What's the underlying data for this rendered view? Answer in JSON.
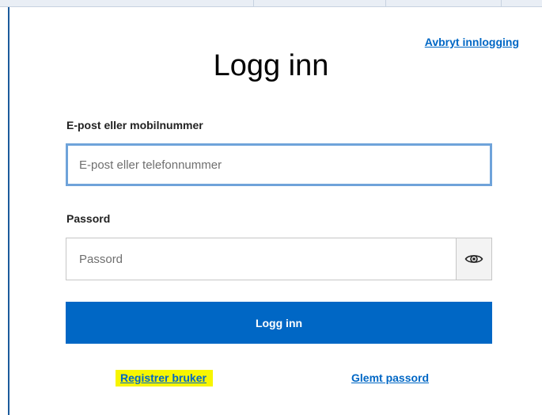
{
  "header": {
    "cancel_label": "Avbryt innlogging",
    "title": "Logg inn"
  },
  "form": {
    "email": {
      "label": "E-post eller mobilnummer",
      "placeholder": "E-post eller telefonnummer",
      "value": ""
    },
    "password": {
      "label": "Passord",
      "placeholder": "Passord",
      "value": "",
      "toggle_icon": "eye-icon"
    },
    "submit_label": "Logg inn"
  },
  "footer": {
    "register_label": "Registrer bruker",
    "forgot_label": "Glemt passord"
  },
  "colors": {
    "primary": "#0067c5",
    "focus_border": "#6fa3da",
    "highlight": "#f7f500",
    "frame_line": "#1c5b9c"
  }
}
